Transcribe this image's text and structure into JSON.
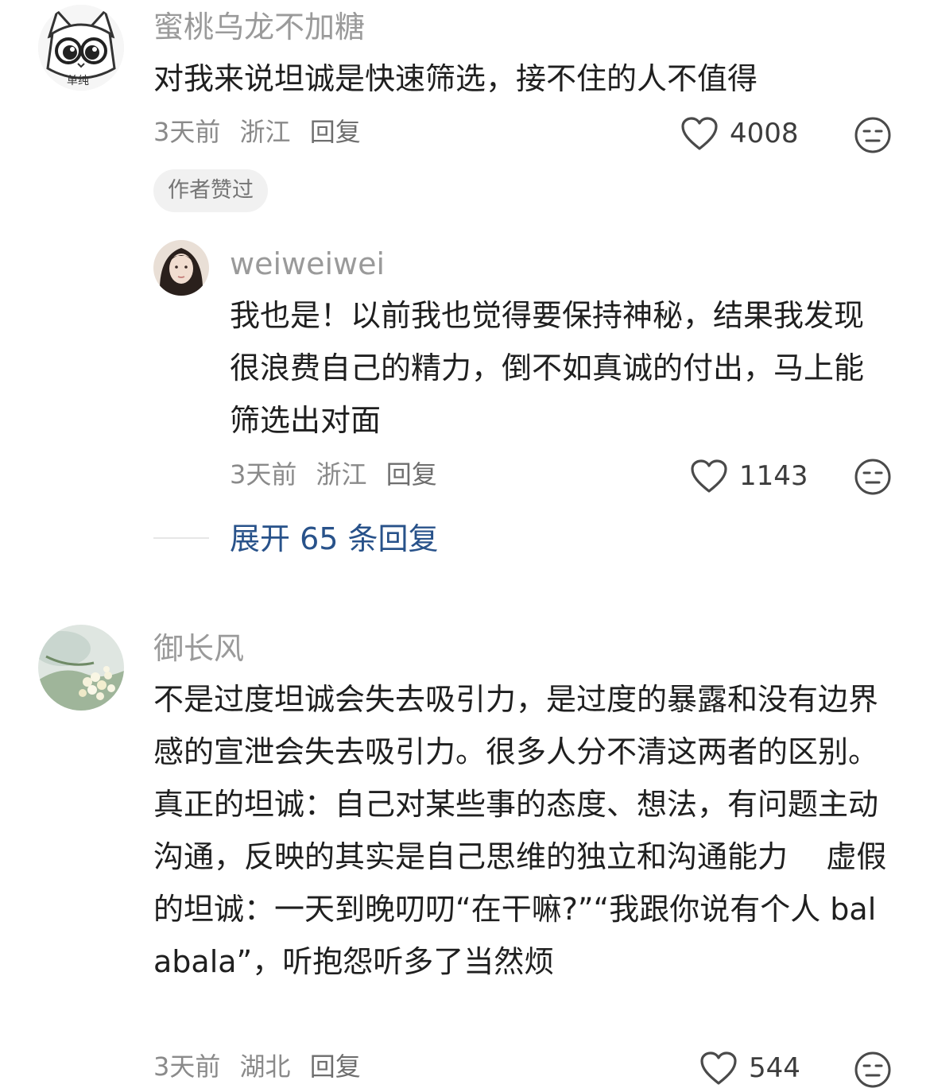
{
  "comments": [
    {
      "username": "蜜桃乌龙不加糖",
      "avatar_text": "单纯",
      "content": "对我来说坦诚是快速筛选，接不住的人不值得",
      "time": "3天前",
      "location": "浙江",
      "reply_label": "回复",
      "likes": "4008",
      "badge": "作者赞过",
      "replies": [
        {
          "username": "weiweiwei",
          "content": "我也是！以前我也觉得要保持神秘，结果我发现很浪费自己的精力，倒不如真诚的付出，马上能筛选出对面",
          "time": "3天前",
          "location": "浙江",
          "reply_label": "回复",
          "likes": "1143"
        }
      ],
      "expand_label": "展开 65 条回复"
    },
    {
      "username": "御长风",
      "content": "不是过度坦诚会失去吸引力，是过度的暴露和没有边界感的宣泄会失去吸引力。很多人分不清这两者的区别。真正的坦诚：自己对某些事的态度、想法，有问题主动沟通，反映的其实是自己思维的独立和沟通能力    虚假的坦诚：一天到晚叨叨“在干嘛?”“我跟你说有个人 balabala”，听抱怨听多了当然烦",
      "time": "3天前",
      "location": "湖北",
      "reply_label": "回复",
      "likes": "544"
    }
  ],
  "icons": {
    "like": "heart-outline-icon",
    "reaction": "neutral-face-icon"
  },
  "colors": {
    "text": "#1f1f1f",
    "username": "#9a9a9a",
    "meta": "#8a8a8a",
    "link": "#28528a",
    "badge_bg": "#f1f1f1"
  }
}
